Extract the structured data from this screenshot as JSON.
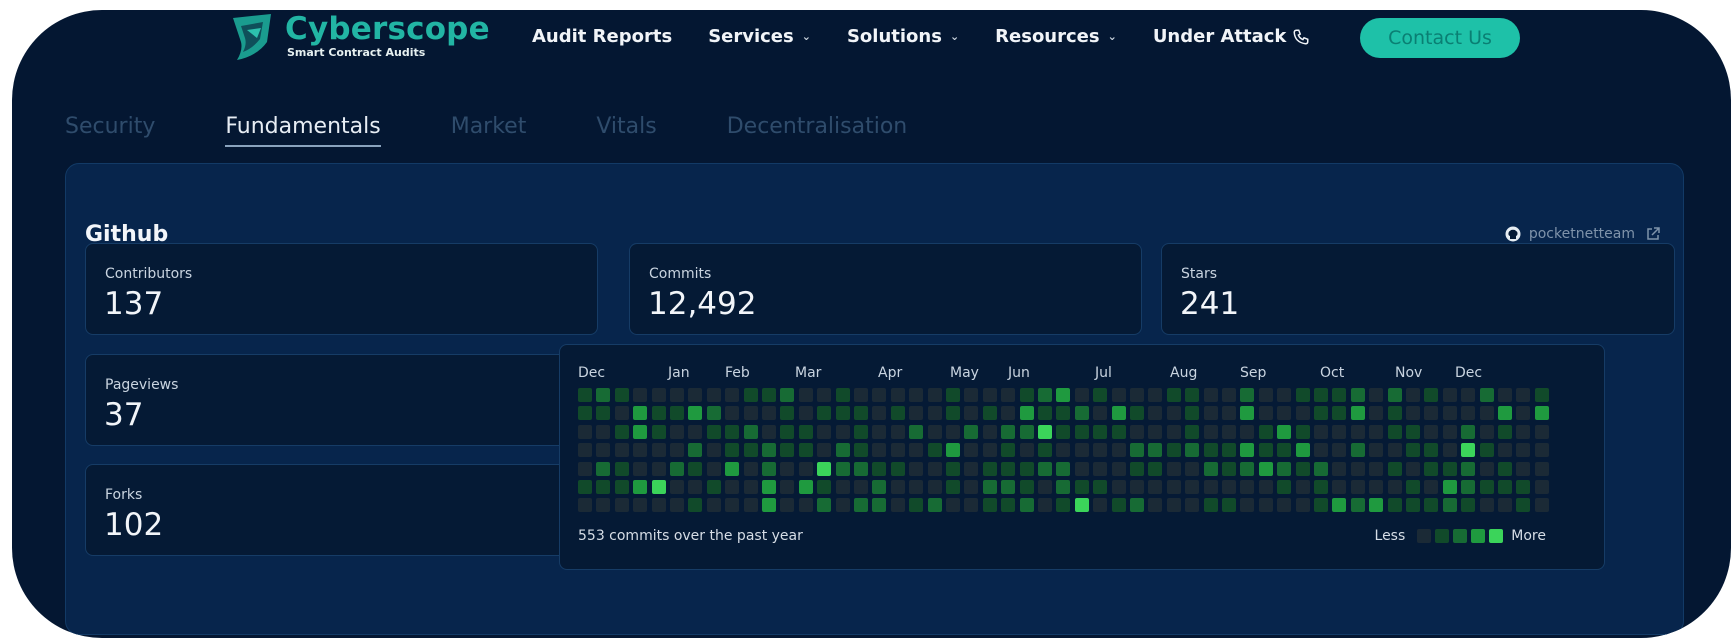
{
  "header": {
    "logo_name": "Cyberscope",
    "logo_subtitle": "Smart Contract Audits",
    "nav": [
      {
        "label": "Audit Reports",
        "dropdown": false
      },
      {
        "label": "Services",
        "dropdown": true
      },
      {
        "label": "Solutions",
        "dropdown": true
      },
      {
        "label": "Resources",
        "dropdown": true
      },
      {
        "label": "Under Attack",
        "dropdown": false,
        "icon": "phone-icon"
      }
    ],
    "contact_label": "Contact Us"
  },
  "tabs": [
    {
      "label": "Security",
      "active": false
    },
    {
      "label": "Fundamentals",
      "active": true
    },
    {
      "label": "Market",
      "active": false
    },
    {
      "label": "Vitals",
      "active": false
    },
    {
      "label": "Decentralisation",
      "active": false
    }
  ],
  "github": {
    "title": "Github",
    "repo_link": "pocketnetteam",
    "stats": {
      "contributors": {
        "label": "Contributors",
        "value": "137"
      },
      "commits": {
        "label": "Commits",
        "value": "12,492"
      },
      "stars": {
        "label": "Stars",
        "value": "241"
      },
      "pageviews": {
        "label": "Pageviews",
        "value": "37"
      },
      "forks": {
        "label": "Forks",
        "value": "102"
      }
    },
    "activity": {
      "months": [
        "Dec",
        "Jan",
        "Feb",
        "Mar",
        "Apr",
        "May",
        "Jun",
        "Jul",
        "Aug",
        "Sep",
        "Oct",
        "Nov",
        "Dec"
      ],
      "summary": "553 commits over the past year",
      "legend_less": "Less",
      "legend_more": "More",
      "colors": [
        "#1b2a36",
        "#114a2a",
        "#176b34",
        "#1f9a3f",
        "#3bd45a"
      ]
    }
  },
  "colors": {
    "background": "#041732",
    "panel": "#07254c",
    "accent": "#1ec1a8"
  }
}
